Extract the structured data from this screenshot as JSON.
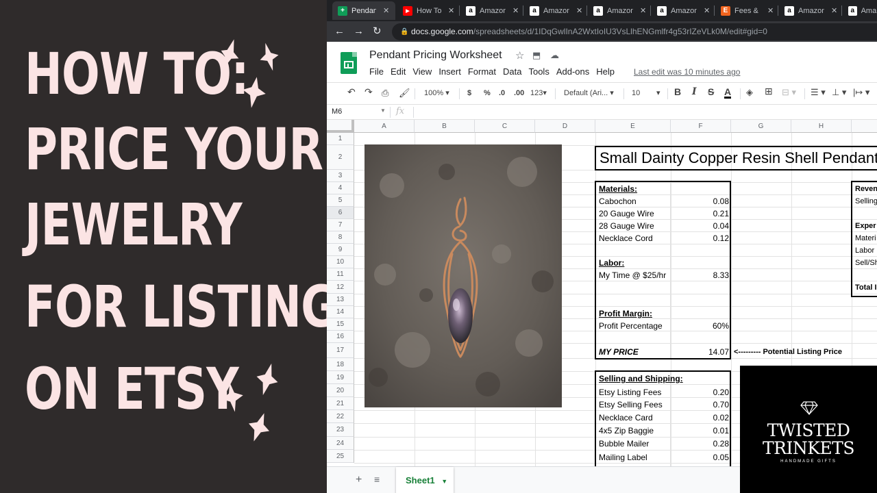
{
  "thumbnail": {
    "headline_lines": [
      "HOW TO:",
      "PRICE YOUR",
      "JEWELRY",
      "FOR LISTING",
      "ON ETSY"
    ]
  },
  "browser": {
    "tabs": [
      {
        "label": "Pendant",
        "icon": "sheets-icon",
        "active": true
      },
      {
        "label": "How To",
        "icon": "youtube-icon"
      },
      {
        "label": "Amazon",
        "icon": "amazon-icon"
      },
      {
        "label": "Amazon",
        "icon": "amazon-icon"
      },
      {
        "label": "Amazon",
        "icon": "amazon-icon"
      },
      {
        "label": "Amazon",
        "icon": "amazon-icon"
      },
      {
        "label": "Fees &",
        "icon": "etsy-icon"
      },
      {
        "label": "Amazon",
        "icon": "amazon-icon"
      },
      {
        "label": "Ama",
        "icon": "amazon-icon"
      }
    ],
    "url_host": "docs.google.com",
    "url_path": "/spreadsheets/d/1IDqGwlInA2WxtIoIU3VsLlhENGmlfr4g53rIZeVLk0M/edit#gid=0"
  },
  "sheets": {
    "title": "Pendant Pricing Worksheet",
    "menu": [
      "File",
      "Edit",
      "View",
      "Insert",
      "Format",
      "Data",
      "Tools",
      "Add-ons",
      "Help"
    ],
    "last_edit": "Last edit was 10 minutes ago",
    "toolbar": {
      "zoom": "100%",
      "currency": "$",
      "percent": "%",
      "dec_less": ".0",
      "dec_more": ".00",
      "format_more": "123",
      "font": "Default (Ari...",
      "font_size": "10",
      "bold": "B",
      "italic": "I",
      "strike": "S",
      "textcolor": "A"
    },
    "name_box": "M6",
    "fx": "fx",
    "columns": [
      "A",
      "B",
      "C",
      "D",
      "E",
      "F",
      "G",
      "H"
    ],
    "rows": [
      "1",
      "2",
      "3",
      "4",
      "5",
      "6",
      "7",
      "8",
      "9",
      "10",
      "11",
      "12",
      "13",
      "14",
      "15",
      "16",
      "17",
      "18",
      "19",
      "20",
      "21",
      "22",
      "23",
      "24",
      "25"
    ],
    "big_title": "Small Dainty Copper Resin Shell Pendant",
    "materials_header": "Materials:",
    "materials": [
      {
        "name": "Cabochon",
        "value": "0.08"
      },
      {
        "name": "20 Gauge Wire",
        "value": "0.21"
      },
      {
        "name": "28 Gauge Wire",
        "value": "0.04"
      },
      {
        "name": "Necklace Cord",
        "value": "0.12"
      }
    ],
    "labor_header": "Labor:",
    "labor": {
      "name": "My Time @ $25/hr",
      "value": "8.33"
    },
    "profit_header": "Profit Margin:",
    "profit": {
      "name": "Profit Percentage",
      "value": "60%"
    },
    "my_price": {
      "name": "MY PRICE",
      "value": "14.07"
    },
    "potential_note": "<--------- Potential Listing Price",
    "selling_header": "Selling and Shipping:",
    "selling": [
      {
        "name": "Etsy Listing Fees",
        "value": "0.20"
      },
      {
        "name": "Etsy Selling Fees",
        "value": "0.70"
      },
      {
        "name": "Necklace Card",
        "value": "0.02"
      },
      {
        "name": "4x5 Zip Baggie",
        "value": "0.01"
      },
      {
        "name": "Bubble Mailer",
        "value": "0.28"
      },
      {
        "name": "Mailing Label",
        "value": "0.05"
      }
    ],
    "right_box": {
      "revenue": "Reven",
      "selling": "Selling",
      "expenses": "Exper",
      "materials": "Materi",
      "labor": "Labor",
      "sell_ship": "Sell/Sh",
      "total": "Total I"
    },
    "sheet_tab": "Sheet1"
  },
  "logo": {
    "line1": "TWISTED",
    "line2": "TRINKETS",
    "sub": "HANDMADE GIFTS"
  }
}
